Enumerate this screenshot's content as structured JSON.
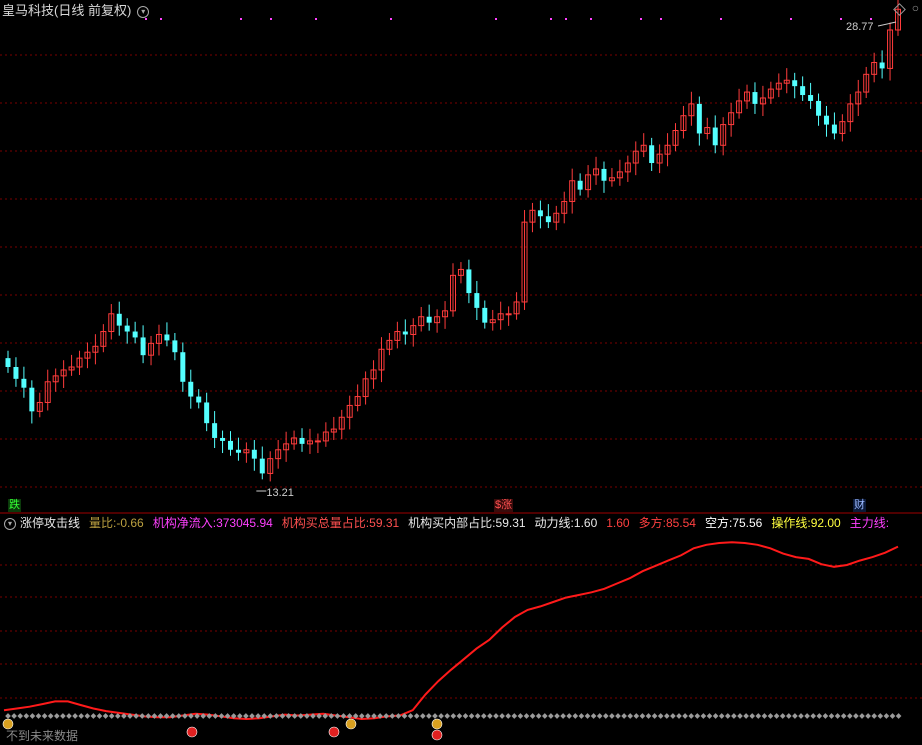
{
  "header": {
    "title": "皇马科技",
    "period": "(日线 前复权)",
    "settings_icon": "chevron-down-circle-icon"
  },
  "colors": {
    "up": "#ff3c3c",
    "down": "#54ffff",
    "grid": "#7a0000",
    "divider": "#a00000",
    "background": "#000000",
    "indicator_line": "#ff1a1a",
    "marker_gray": "#9a9a9a",
    "dot_magenta": "#ff40ff"
  },
  "main_chart": {
    "high_label": "28.77",
    "low_label": "13.21",
    "events": [
      {
        "label": "跌",
        "color": "#33ff33"
      },
      {
        "label": "涨",
        "color": "#ff5050",
        "prefix": "$"
      },
      {
        "label": "财",
        "color": "#9ab8ff"
      }
    ]
  },
  "indicator": {
    "name": "涨停攻击线",
    "items": [
      {
        "label": "量比:",
        "value": "-0.66",
        "color": "#bba040"
      },
      {
        "label": "机构净流入:",
        "value": "373045.94",
        "color": "#ff40ff"
      },
      {
        "label": "机构买总量占比:",
        "value": "59.31",
        "color": "#ff5050"
      },
      {
        "label": "机构买内部占比:",
        "value": "59.31",
        "color": "#e8e8e8"
      },
      {
        "label": "动力线:",
        "value": "1.60",
        "color": "#e8e8e8"
      },
      {
        "label": "",
        "value": "1.60",
        "color": "#ff4040"
      },
      {
        "label": "多方:",
        "value": "85.54",
        "color": "#ff4040"
      },
      {
        "label": "空方:",
        "value": "75.56",
        "color": "#ffffff"
      },
      {
        "label": "操作线:",
        "value": "92.00",
        "color": "#ffff40"
      },
      {
        "label": "主力线:",
        "value": "",
        "color": "#ff40ff"
      }
    ],
    "future_label": "不到未来数据"
  },
  "chart_data": {
    "type": "candlestick",
    "title": "皇马科技 (日线 前复权)",
    "price_range": [
      13.21,
      28.77
    ],
    "annotations": [
      {
        "text": "28.77",
        "type": "high"
      },
      {
        "text": "13.21",
        "type": "low"
      }
    ],
    "indicator_series": {
      "name": "涨停攻击线",
      "values": [
        2,
        4,
        6,
        9,
        12,
        12,
        8,
        4,
        1,
        -1,
        -3,
        -5,
        -6,
        -6,
        -4,
        -2,
        -3,
        -5,
        -7,
        -8,
        -7,
        -5,
        -3,
        -4,
        -3,
        -2,
        -4,
        -6,
        -8,
        -7,
        -5,
        -4,
        2,
        20,
        35,
        48,
        60,
        72,
        82,
        96,
        108,
        116,
        120,
        125,
        130,
        133,
        136,
        140,
        146,
        152,
        160,
        166,
        172,
        178,
        186,
        190,
        192,
        193,
        192,
        190,
        186,
        180,
        176,
        174,
        168,
        165,
        167,
        172,
        176,
        181,
        188
      ]
    }
  }
}
